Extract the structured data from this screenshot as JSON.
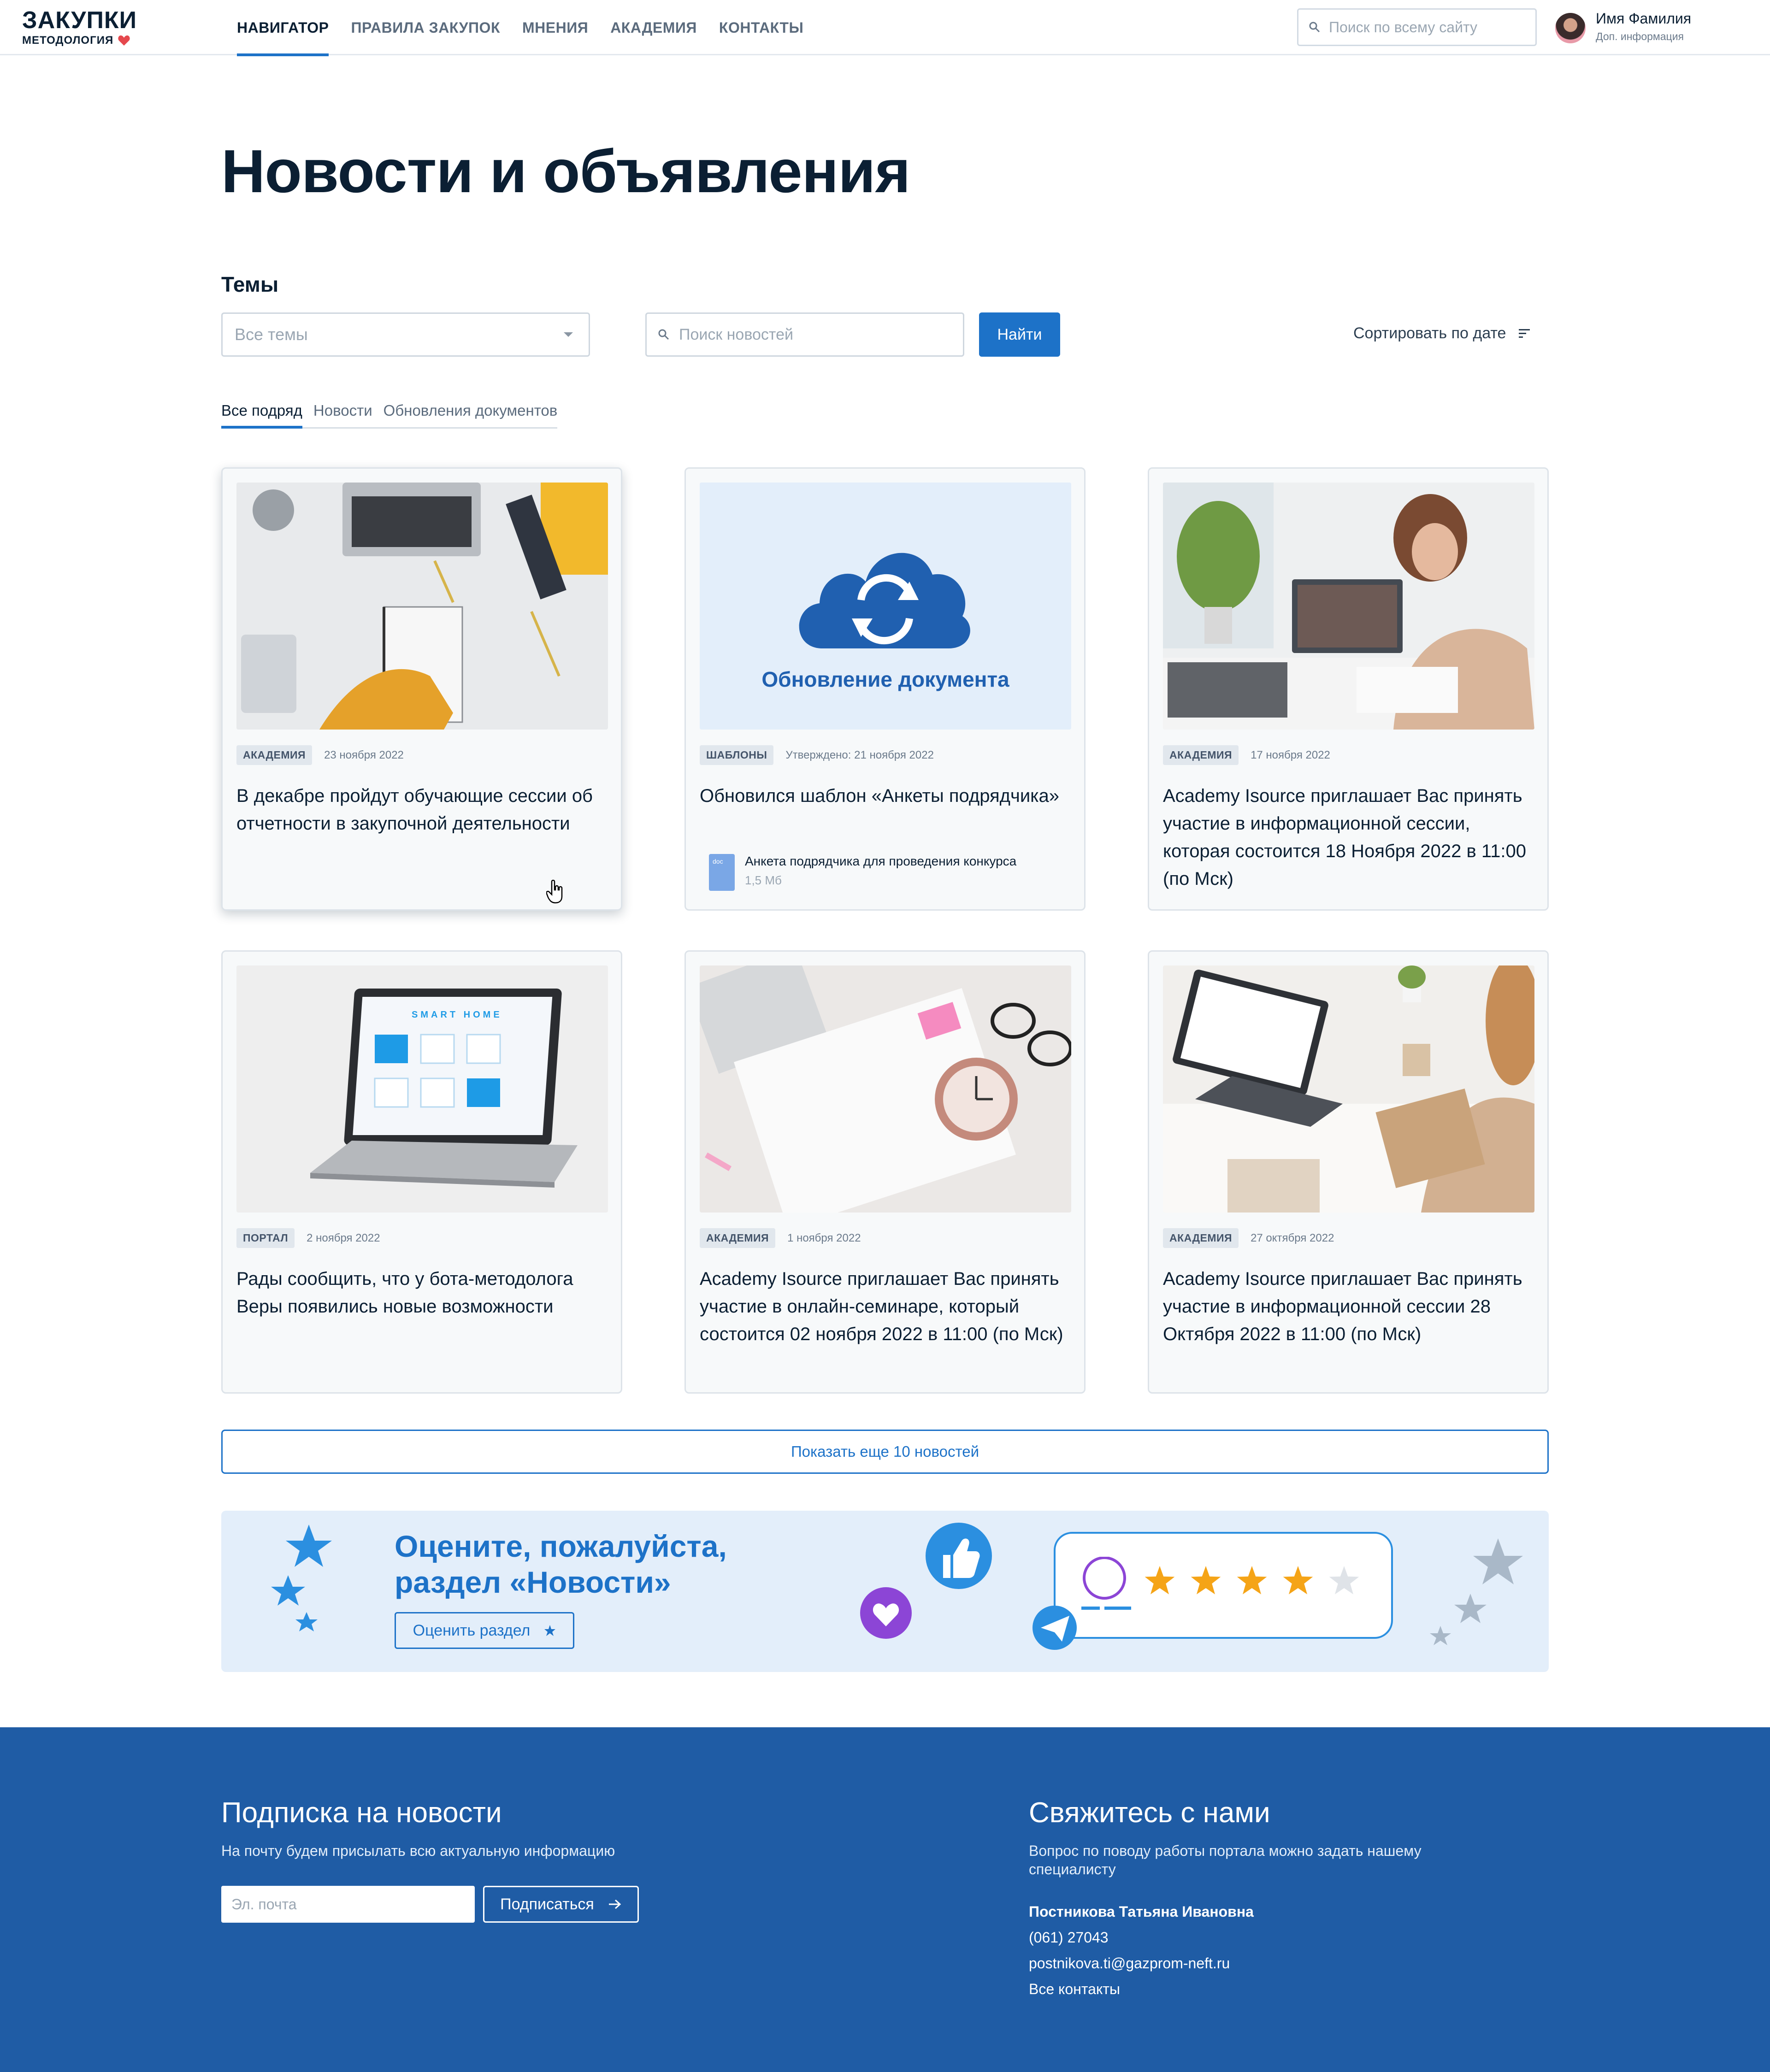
{
  "header": {
    "logo_title": "ЗАКУПКИ",
    "logo_sub": "МЕТОДОЛОГИЯ",
    "nav": [
      {
        "label": "НАВИГАТОР",
        "active": true
      },
      {
        "label": "ПРАВИЛА ЗАКУПОК",
        "active": false
      },
      {
        "label": "МНЕНИЯ",
        "active": false
      },
      {
        "label": "АКАДЕМИЯ",
        "active": false
      },
      {
        "label": "КОНТАКТЫ",
        "active": false
      }
    ],
    "search_placeholder": "Поиск по всему сайту",
    "user_name": "Имя Фамилия",
    "user_sub": "Доп. информация"
  },
  "page": {
    "title": "Новости и объявления",
    "themes_label": "Темы",
    "select_value": "Все темы",
    "search_placeholder": "Поиск новостей",
    "find_label": "Найти",
    "sort_label": "Сортировать по дате",
    "tabs": [
      "Все подряд",
      "Новости",
      "Обновления документов"
    ]
  },
  "cards": [
    {
      "tag": "АКАДЕМИЯ",
      "date": "23 ноября 2022",
      "title": "В декабре пройдут обучающие сессии об отчетности в закупочной деятельности"
    },
    {
      "tag": "ШАБЛОНЫ",
      "date": "Утверждено: 21 ноября 2022",
      "title": "Обновился шаблон «Анкеты подрядчика»",
      "image_caption": "Обновление документа",
      "attachment": {
        "icon": "doc",
        "name": "Анкета подрядчика для проведения конкурса",
        "size": "1,5 Мб"
      }
    },
    {
      "tag": "АКАДЕМИЯ",
      "date": "17 ноября 2022",
      "title": "Academy Isource приглашает Вас принять участие в информационной сессии, которая состоится 18 Ноября 2022 в 11:00 (по Мск)"
    },
    {
      "tag": "ПОРТАЛ",
      "date": "2 ноября 2022",
      "title": "Рады сообщить, что у бота-методолога Веры появились новые возможности",
      "image_caption": "SMART HOME"
    },
    {
      "tag": "АКАДЕМИЯ",
      "date": "1 ноября 2022",
      "title": "Academy Isource приглашает Вас принять участие в онлайн-семинаре, который состоится 02 ноября 2022 в 11:00 (по Мск)"
    },
    {
      "tag": "АКАДЕМИЯ",
      "date": "27 октября 2022",
      "title": "Academy Isource приглашает Вас принять участие в информационной сессии 28 Октября 2022 в 11:00 (по Мск)"
    }
  ],
  "more_label": "Показать еще 10 новостей",
  "banner": {
    "title_line1": "Оцените, пожалуйста,",
    "title_line2": "раздел «Новости»",
    "button_label": "Оценить раздел",
    "stars_filled": 4,
    "stars_total": 5
  },
  "footer": {
    "subscribe_title": "Подписка на новости",
    "subscribe_text": "На почту будем присылать всю актуальную информацию",
    "email_placeholder": "Эл. почта",
    "subscribe_button": "Подписаться",
    "contact_title": "Свяжитесь с нами",
    "contact_text_line1": "Вопрос по поводу работы портала можно задать нашему",
    "contact_text_line2": "специалисту",
    "contact_name": "Постникова Татьяна Ивановна",
    "contact_phone": "(061) 27043",
    "contact_email": "postnikova.ti@gazprom-neft.ru",
    "contact_all": "Все контакты"
  },
  "colors": {
    "accent": "#1d72c8",
    "footer_bg": "#1f5ca5",
    "banner_bg": "#e3eefa",
    "heart": "#e5484d",
    "star": "#f5a417"
  }
}
